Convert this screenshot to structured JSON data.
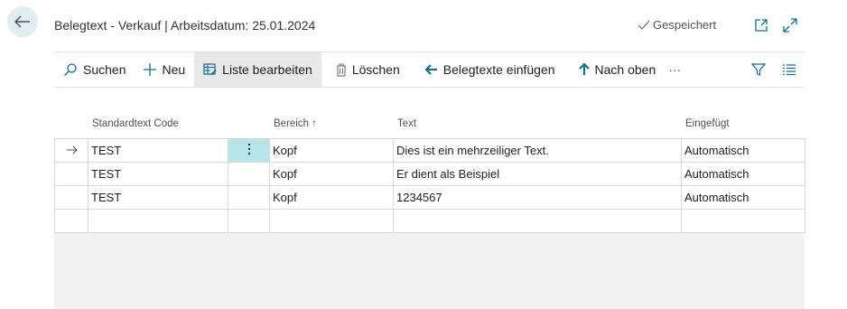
{
  "header": {
    "title": "Belegtext - Verkauf | Arbeitsdatum: 25.01.2024",
    "saved_label": "Gespeichert"
  },
  "toolbar": {
    "search": "Suchen",
    "new": "Neu",
    "edit_list": "Liste bearbeiten",
    "delete": "Löschen",
    "insert_texts": "Belegtexte einfügen",
    "move_up": "Nach oben",
    "more": "···"
  },
  "table": {
    "columns": {
      "code": "Standardtext Code",
      "area": "Bereich ↑",
      "text": "Text",
      "inserted": "Eingefügt"
    },
    "rows": [
      {
        "code": "TEST",
        "area": "Kopf",
        "text": "Dies ist ein mehrzeiliger Text.",
        "inserted": "Automatisch"
      },
      {
        "code": "TEST",
        "area": "Kopf",
        "text": "Er dient als Beispiel",
        "inserted": "Automatisch"
      },
      {
        "code": "TEST",
        "area": "Kopf",
        "text": "1234567",
        "inserted": "Automatisch"
      },
      {
        "code": "",
        "area": "",
        "text": "",
        "inserted": ""
      }
    ]
  },
  "colors": {
    "accent": "#0f6f8f",
    "selected_cell": "#b7e4e8",
    "back_button_bg": "#e0eef3"
  }
}
